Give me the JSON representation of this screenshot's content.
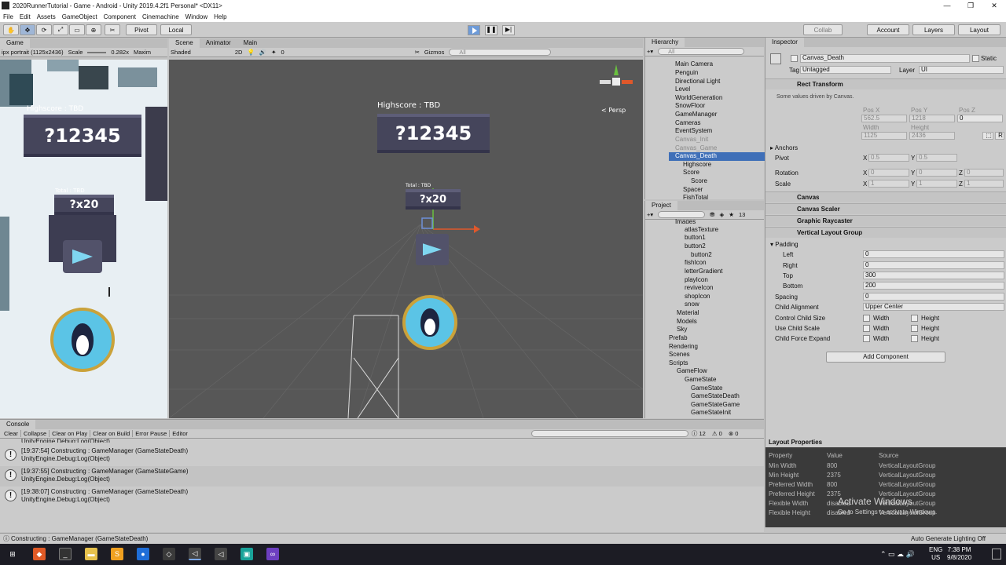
{
  "window": {
    "title": "2020RunnerTutorial - Game - Android - Unity 2019.4.2f1 Personal* <DX11>",
    "minimize": "—",
    "maximize": "❐",
    "close": "✕"
  },
  "menu": [
    "File",
    "Edit",
    "Assets",
    "GameObject",
    "Component",
    "Cinemachine",
    "Window",
    "Help"
  ],
  "toolbar": {
    "pivot": "Pivot",
    "local": "Local",
    "collab": "Collab",
    "account": "Account",
    "layers": "Layers",
    "layout": "Layout"
  },
  "game": {
    "tab": "Game",
    "resolution": "ipx portrait (1125x2436)",
    "scale_label": "Scale",
    "scale_value": "0.282x",
    "maxim": "Maxim",
    "highscore_label": "Highscore : TBD",
    "highscore_value": "?12345",
    "total_label": "Total : TBD",
    "total_value": "?x20"
  },
  "scene": {
    "tab_scene": "Scene",
    "tab_animator": "Animator",
    "tab_main": "Main",
    "shading": "Shaded",
    "mode2d": "2D",
    "layers_count": "0",
    "gizmos": "Gizmos",
    "search_placeholder": "All",
    "persp": "< Persp",
    "highscore_label": "Highscore : TBD",
    "highscore_value": "?12345",
    "total_label": "Total : TBD",
    "total_value": "?x20"
  },
  "hierarchy": {
    "title": "Hierarchy",
    "search_placeholder": "All",
    "items": [
      "Main Camera",
      "Penguin",
      "Directional Light",
      "Level",
      "WorldGeneration",
      "SnowFloor",
      "GameManager",
      "Cameras",
      "EventSystem",
      "Canvas_Init",
      "Canvas_Game",
      "Canvas_Death",
      "Highscore",
      "Score",
      "Score",
      "Spacer",
      "FishTotal"
    ]
  },
  "project": {
    "title": "Project",
    "count": "13",
    "items": [
      "Images",
      "atlasTexture",
      "button1",
      "button2",
      "button2",
      "fishIcon",
      "letterGradient",
      "playIcon",
      "reviveIcon",
      "shopIcon",
      "snow",
      "Material",
      "Models",
      "Sky",
      "Prefab",
      "Rendering",
      "Scenes",
      "Scripts",
      "GameFlow",
      "GameState",
      "GameState",
      "GameStateDeath",
      "GameStateGame",
      "GameStateInit"
    ]
  },
  "inspector": {
    "title": "Inspector",
    "object_name": "Canvas_Death",
    "static": "Static",
    "tag_label": "Tag",
    "tag_value": "Untagged",
    "layer_label": "Layer",
    "layer_value": "UI",
    "rect_transform": "Rect Transform",
    "driven_note": "Some values driven by Canvas.",
    "pos_x_label": "Pos X",
    "pos_y_label": "Pos Y",
    "pos_z_label": "Pos Z",
    "pos_x": "562.5",
    "pos_y": "1218",
    "pos_z": "0",
    "width_label": "Width",
    "height_label": "Height",
    "width": "1125",
    "height": "2436",
    "r_btn": "R",
    "anchors": "Anchors",
    "pivot": "Pivot",
    "pivot_x": "0.5",
    "pivot_y": "0.5",
    "rotation": "Rotation",
    "rot_x": "0",
    "rot_y": "0",
    "rot_z": "0",
    "scale": "Scale",
    "scale_x": "1",
    "scale_y": "1",
    "scale_z": "1",
    "x": "X",
    "y": "Y",
    "z": "Z",
    "components": [
      "Canvas",
      "Canvas Scaler",
      "Graphic Raycaster",
      "Vertical Layout Group"
    ],
    "padding": "Padding",
    "left": "Left",
    "right": "Right",
    "top": "Top",
    "bottom": "Bottom",
    "left_v": "0",
    "right_v": "0",
    "top_v": "300",
    "bottom_v": "200",
    "spacing": "Spacing",
    "spacing_v": "0",
    "child_alignment": "Child Alignment",
    "child_alignment_v": "Upper Center",
    "control_child_size": "Control Child Size",
    "use_child_scale": "Use Child Scale",
    "child_force_expand": "Child Force Expand",
    "width_cb": "Width",
    "height_cb": "Height",
    "add_component": "Add Component"
  },
  "layout_properties": {
    "title": "Layout Properties",
    "headers": [
      "Property",
      "Value",
      "Source"
    ],
    "rows": [
      [
        "Min Width",
        "800",
        "VerticalLayoutGroup"
      ],
      [
        "Min Height",
        "2375",
        "VerticalLayoutGroup"
      ],
      [
        "Preferred Width",
        "800",
        "VerticalLayoutGroup"
      ],
      [
        "Preferred Height",
        "2375",
        "VerticalLayoutGroup"
      ],
      [
        "Flexible Width",
        "disabled",
        "VerticalLayoutGroup"
      ],
      [
        "Flexible Height",
        "disabled",
        "VerticalLayoutGroup"
      ]
    ],
    "activate": "Activate Windows",
    "activate_sub": "Go to Settings to activate Windows."
  },
  "console": {
    "title": "Console",
    "buttons": [
      "Clear",
      "Collapse",
      "Clear on Play",
      "Clear on Build",
      "Error Pause",
      "Editor"
    ],
    "count": "12",
    "warn": "0",
    "err": "0",
    "first_line": "UnityEngine.Debug:Log(Object)",
    "logs": [
      [
        "[19:37:54] Constructing : GameManager (GameStateDeath)",
        "UnityEngine.Debug:Log(Object)"
      ],
      [
        "[19:37:55] Constructing : GameManager (GameStateGame)",
        "UnityEngine.Debug:Log(Object)"
      ],
      [
        "[19:38:07] Constructing : GameManager (GameStateDeath)",
        "UnityEngine.Debug:Log(Object)"
      ]
    ]
  },
  "status": {
    "message": "Constructing : GameManager (GameStateDeath)",
    "right": "Auto Generate Lighting Off"
  },
  "taskbar": {
    "lang": "ENG",
    "region": "US",
    "time": "7:38 PM",
    "date": "9/8/2020"
  },
  "colors": {
    "selection": "#3f6fb8",
    "scene_bg": "#575757",
    "board": "#45455b",
    "penguin_bg": "#5bc4e6"
  }
}
